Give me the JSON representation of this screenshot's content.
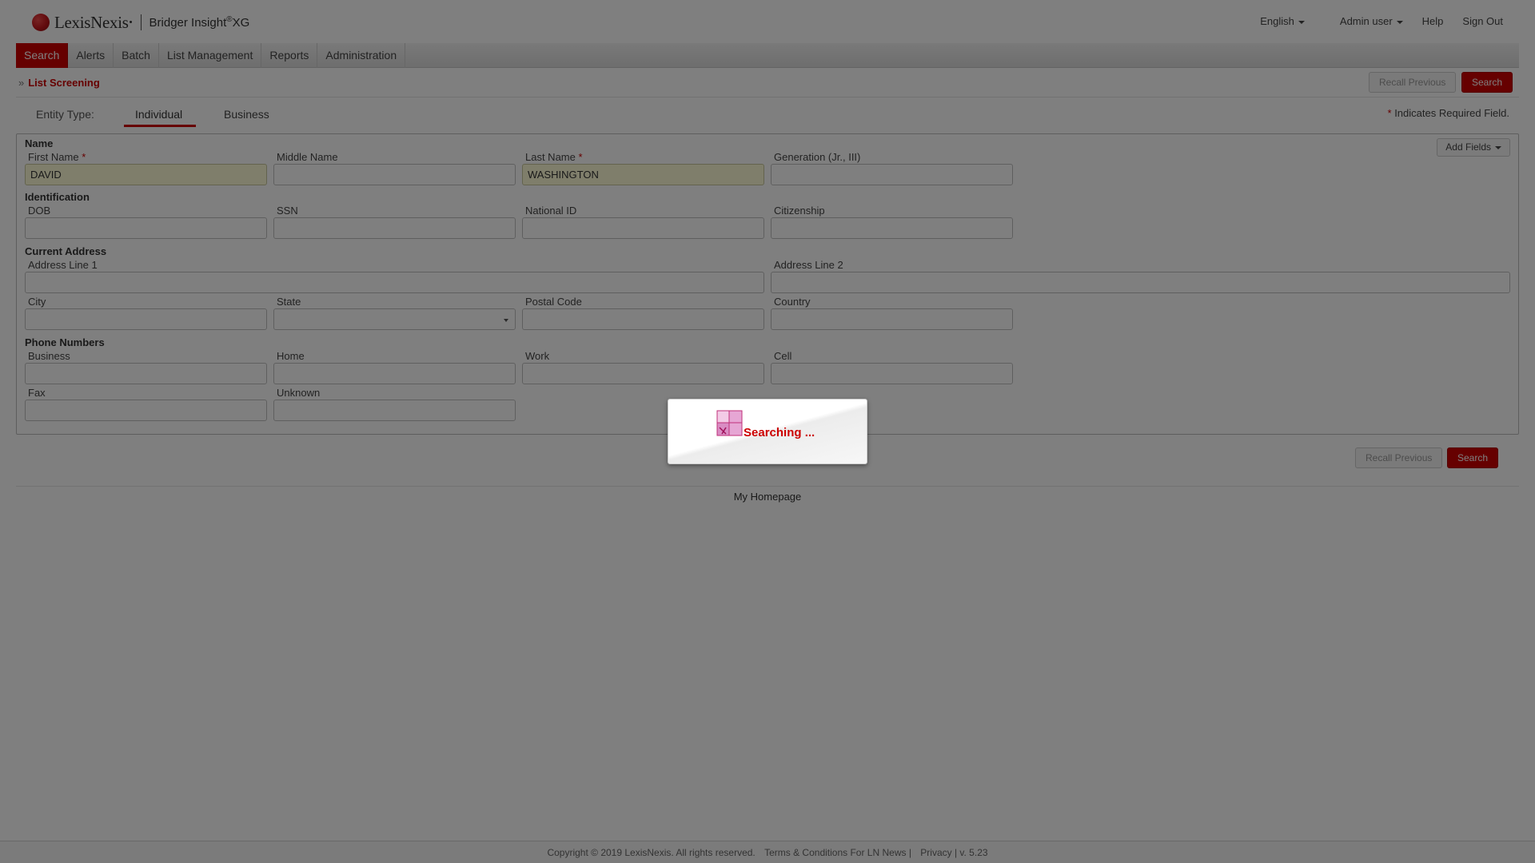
{
  "header": {
    "brand": "LexisNexis",
    "product": "Bridger Insight",
    "product_suffix": "XG",
    "language": "English",
    "user": "Admin user",
    "help": "Help",
    "sign_out": "Sign Out"
  },
  "nav": {
    "items": [
      {
        "label": "Search",
        "active": true
      },
      {
        "label": "Alerts"
      },
      {
        "label": "Batch"
      },
      {
        "label": "List Management"
      },
      {
        "label": "Reports"
      },
      {
        "label": "Administration"
      }
    ]
  },
  "page": {
    "breadcrumb": "List Screening",
    "recall_previous": "Recall Previous",
    "search": "Search",
    "required_note": "Indicates Required Field.",
    "required_star": "*"
  },
  "entity": {
    "label": "Entity Type:",
    "tabs": [
      "Individual",
      "Business"
    ],
    "selected": "Individual"
  },
  "form": {
    "add_fields": "Add Fields",
    "name": {
      "title": "Name",
      "first_name_label": "First Name",
      "first_name_value": "DAVID",
      "middle_name_label": "Middle Name",
      "middle_name_value": "",
      "last_name_label": "Last Name",
      "last_name_value": "WASHINGTON",
      "generation_label": "Generation (Jr., III)",
      "generation_value": ""
    },
    "identification": {
      "title": "Identification",
      "dob_label": "DOB",
      "ssn_label": "SSN",
      "national_id_label": "National ID",
      "citizenship_label": "Citizenship"
    },
    "address": {
      "title": "Current Address",
      "line1_label": "Address Line 1",
      "line2_label": "Address Line 2",
      "city_label": "City",
      "state_label": "State",
      "postal_label": "Postal Code",
      "country_label": "Country"
    },
    "phones": {
      "title": "Phone Numbers",
      "business_label": "Business",
      "home_label": "Home",
      "work_label": "Work",
      "cell_label": "Cell",
      "fax_label": "Fax",
      "unknown_label": "Unknown"
    }
  },
  "footer": {
    "my_homepage": "My Homepage",
    "copyright": "Copyright © 2019 LexisNexis. All rights reserved.",
    "terms": "Terms & Conditions For LN News |",
    "privacy": "Privacy | v. 5.23"
  },
  "modal": {
    "message": "Searching ..."
  },
  "colors": {
    "accent": "#cc0000",
    "required_field_bg": "#fffdd7"
  }
}
